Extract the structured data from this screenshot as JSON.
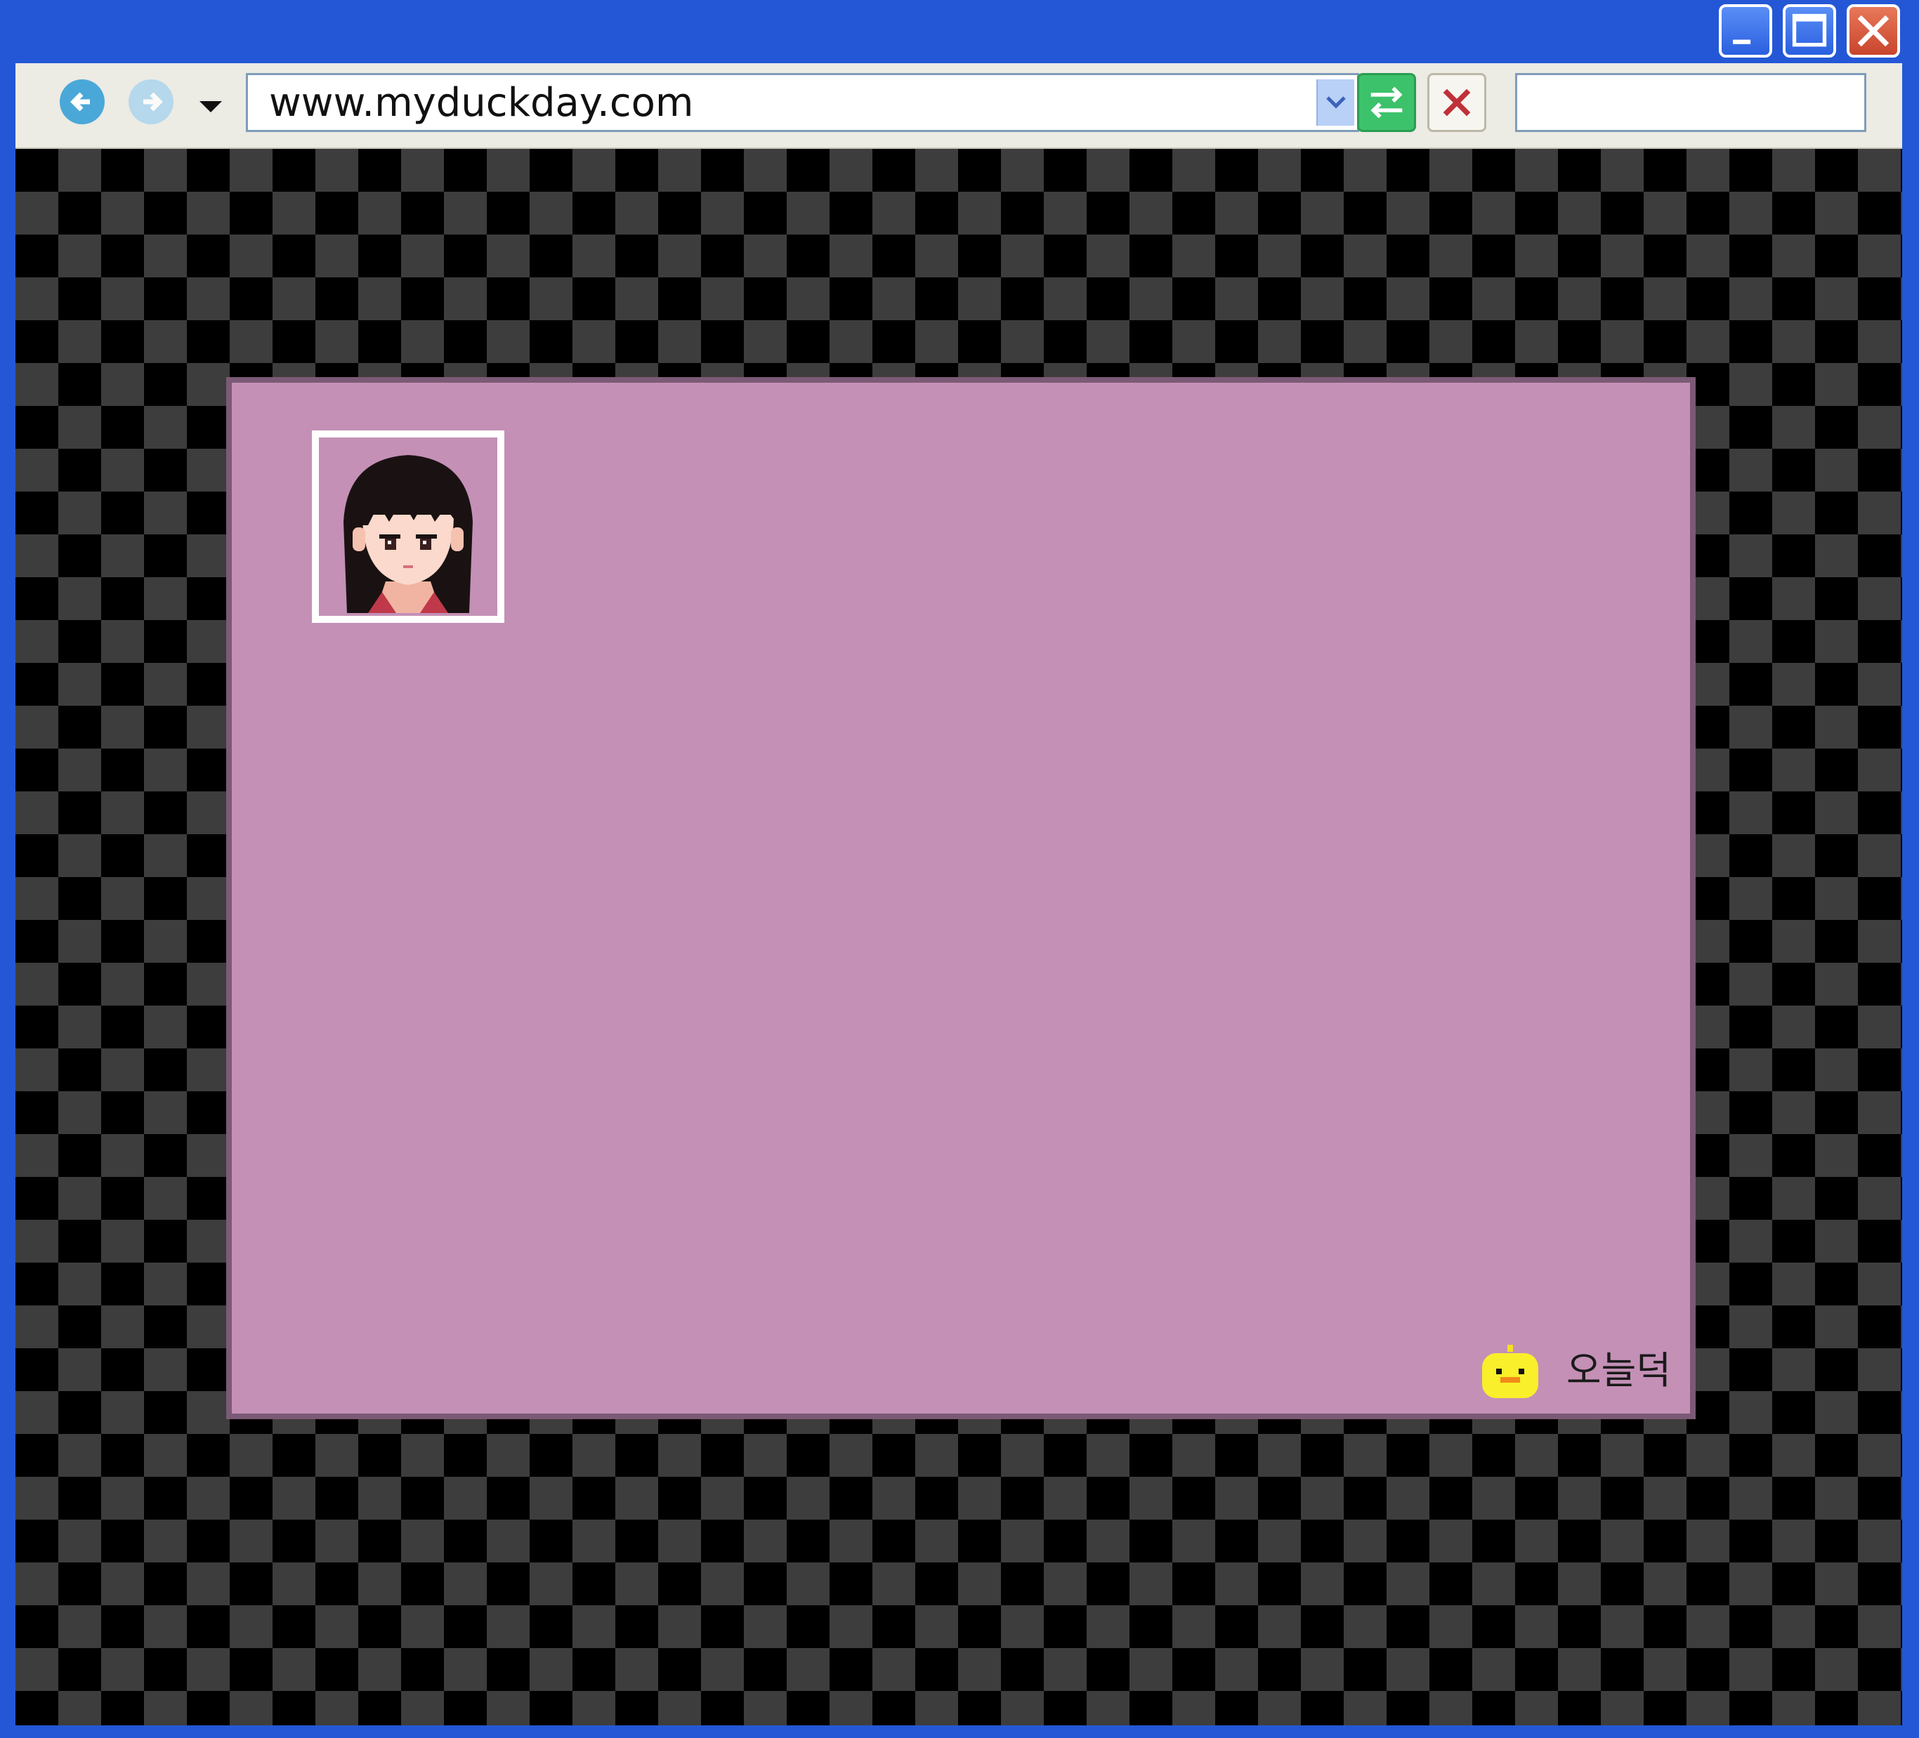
{
  "window": {
    "controls": [
      "minimize",
      "maximize",
      "close"
    ]
  },
  "toolbar": {
    "address_value": "www.myduckday.com",
    "search_value": "",
    "icons": [
      "back-arrow-icon",
      "forward-arrow-icon",
      "history-dropdown-icon",
      "address-dropdown-icon",
      "go-refresh-icon",
      "stop-icon"
    ]
  },
  "page": {
    "background": "checkerboard",
    "card_color": "#c490b6",
    "avatar": "girl-portrait",
    "brand_label": "오늘덕",
    "brand_icon": "duck-icon"
  }
}
